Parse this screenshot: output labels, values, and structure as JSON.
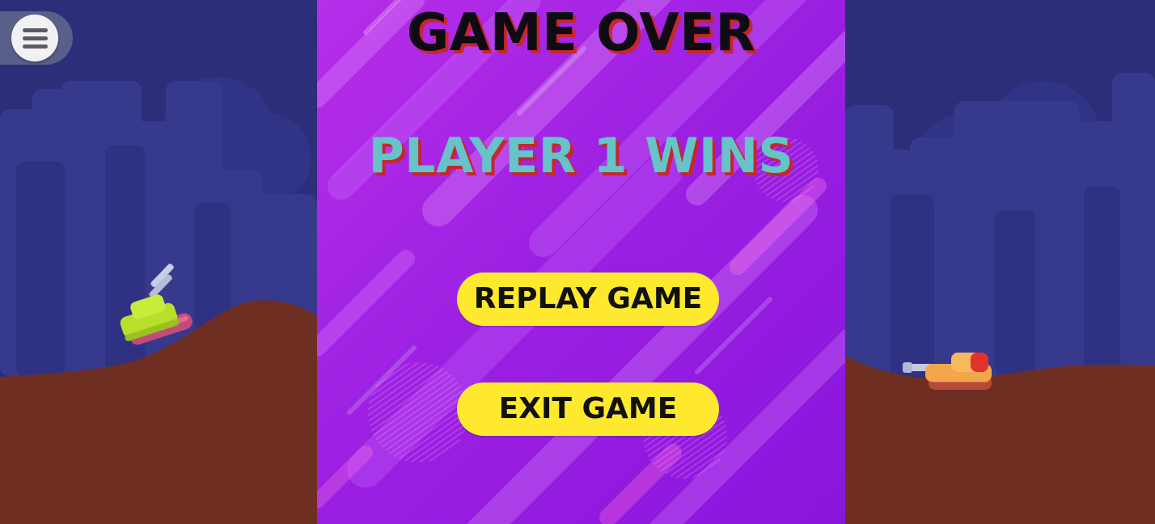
{
  "game": {
    "title": "GAME OVER",
    "winner_message": "PLAYER 1 WINS"
  },
  "buttons": {
    "replay_label": "REPLAY GAME",
    "exit_label": "EXIT GAME"
  },
  "menu": {
    "icon": "hamburger-menu-icon"
  },
  "players": {
    "player1_tank": "green-tank",
    "player2_tank": "orange-tank"
  },
  "colors": {
    "sky": "#2c2e7a",
    "buildings": "#3a3b8a",
    "ground": "#6e2f22",
    "panel_primary": "#a21ee0",
    "button": "#ffe92e",
    "winner_text": "#66c3c8",
    "text_shadow": "#c6262e"
  }
}
